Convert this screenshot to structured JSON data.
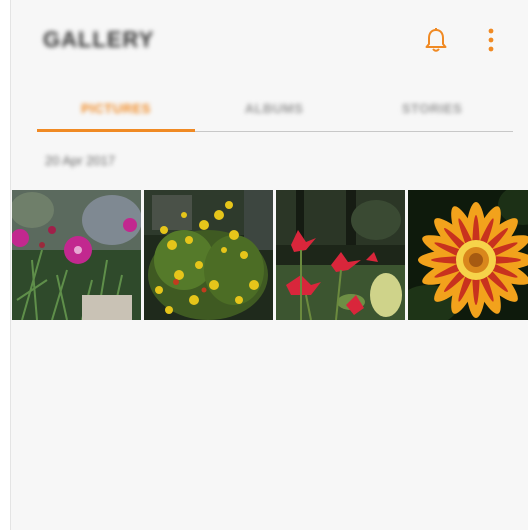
{
  "appbar": {
    "title": "GALLERY",
    "notification_icon": "bell-icon",
    "more_icon": "more-vertical-icon"
  },
  "tabs": [
    {
      "label": "PICTURES",
      "active": true
    },
    {
      "label": "ALBUMS",
      "active": false
    },
    {
      "label": "STORIES",
      "active": false
    }
  ],
  "section": {
    "date": "20 Apr 2017"
  },
  "photos": [
    {
      "subject": "pink-carnation"
    },
    {
      "subject": "yellow-flowering-shrub"
    },
    {
      "subject": "red-flowers"
    },
    {
      "subject": "gazania-flower"
    }
  ],
  "colors": {
    "accent": "#f08a24",
    "background": "#f7f7f7"
  }
}
